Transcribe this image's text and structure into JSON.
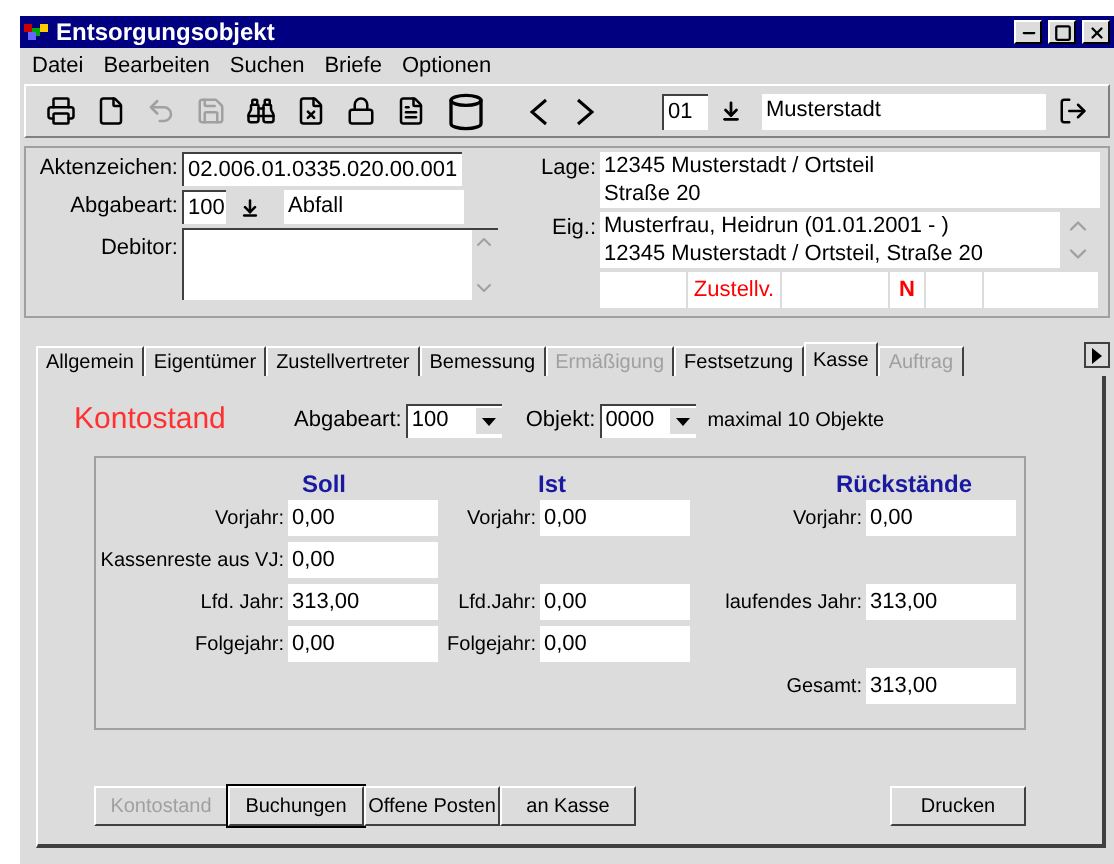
{
  "window": {
    "title": "Entsorgungsobjekt"
  },
  "menu": [
    "Datei",
    "Bearbeiten",
    "Suchen",
    "Briefe",
    "Optionen"
  ],
  "toolbar": {
    "buttons": [
      {
        "kind": "print",
        "disabled": false
      },
      {
        "kind": "new",
        "disabled": false
      },
      {
        "kind": "undo",
        "disabled": true
      },
      {
        "kind": "save",
        "disabled": true
      },
      {
        "kind": "find",
        "disabled": false
      },
      {
        "kind": "delete",
        "disabled": false
      },
      {
        "kind": "lock",
        "disabled": false
      },
      {
        "kind": "list",
        "disabled": false
      },
      {
        "kind": "barrel",
        "disabled": false
      }
    ],
    "district": "01",
    "place": "Musterstadt"
  },
  "header": {
    "aktenzeichen": {
      "label": "Aktenzeichen:",
      "value": "02.006.01.0335.020.00.001"
    },
    "abgabeart": {
      "label": "Abgabeart:",
      "code": "100",
      "name": "Abfall"
    },
    "debitor": {
      "label": "Debitor:"
    },
    "lage": {
      "label": "Lage:",
      "lines": [
        "12345 Musterstadt / Ortsteil",
        "Straße 20"
      ]
    },
    "eig": {
      "label": "Eig.:",
      "lines": [
        "Musterfrau, Heidrun (01.01.2001 - )",
        "12345 Musterstadt / Ortsteil, Straße 20"
      ]
    },
    "flags": [
      {
        "kind": "empty"
      },
      {
        "kind": "text",
        "text": "Zustellv."
      },
      {
        "kind": "empty"
      },
      {
        "kind": "mark",
        "text": "N"
      },
      {
        "kind": "empty"
      },
      {
        "kind": "empty"
      }
    ]
  },
  "tabs": [
    {
      "label": "Allgemein",
      "selected": false,
      "disabled": false
    },
    {
      "label": "Eigentümer",
      "selected": false,
      "disabled": false
    },
    {
      "label": "Zustellvertreter",
      "selected": false,
      "disabled": false
    },
    {
      "label": "Bemessung",
      "selected": false,
      "disabled": false
    },
    {
      "label": "Ermäßigung",
      "selected": false,
      "disabled": true
    },
    {
      "label": "Festsetzung",
      "selected": false,
      "disabled": false
    },
    {
      "label": "Kasse",
      "selected": true,
      "disabled": false
    },
    {
      "label": "Auftrag",
      "selected": false,
      "disabled": true
    }
  ],
  "kasse": {
    "title": "Kontostand",
    "abgabeart": {
      "label": "Abgabeart:",
      "value": "100"
    },
    "objekt": {
      "label": "Objekt:",
      "value": "0000"
    },
    "note": "maximal 10 Objekte",
    "headings": [
      "Soll",
      "Ist",
      "Rückstände"
    ],
    "rows": [
      {
        "soll": {
          "label": "Vorjahr:",
          "value": "0,00"
        },
        "ist": {
          "label": "Vorjahr:",
          "value": "0,00"
        },
        "rueckstaende": {
          "label": "Vorjahr:",
          "value": "0,00"
        }
      },
      {
        "soll": {
          "label": "Kassenreste aus VJ:",
          "value": "0,00"
        }
      },
      {
        "soll": {
          "label": "Lfd. Jahr:",
          "value": "313,00"
        },
        "ist": {
          "label": "Lfd.Jahr:",
          "value": "0,00"
        },
        "rueckstaende": {
          "label": "laufendes Jahr:",
          "value": "313,00"
        }
      },
      {
        "soll": {
          "label": "Folgejahr:",
          "value": "0,00"
        },
        "ist": {
          "label": "Folgejahr:",
          "value": "0,00"
        }
      },
      {
        "rueckstaende": {
          "label": "Gesamt:",
          "value": "313,00"
        }
      }
    ],
    "buttons": [
      {
        "label": "Kontostand",
        "disabled": true,
        "focused": false
      },
      {
        "label": "Buchungen",
        "disabled": false,
        "focused": true
      },
      {
        "label": "Offene Posten",
        "disabled": false,
        "focused": false
      },
      {
        "label": "an Kasse",
        "disabled": false,
        "focused": false
      }
    ],
    "print_button": {
      "label": "Drucken",
      "disabled": false,
      "focused": false
    }
  }
}
